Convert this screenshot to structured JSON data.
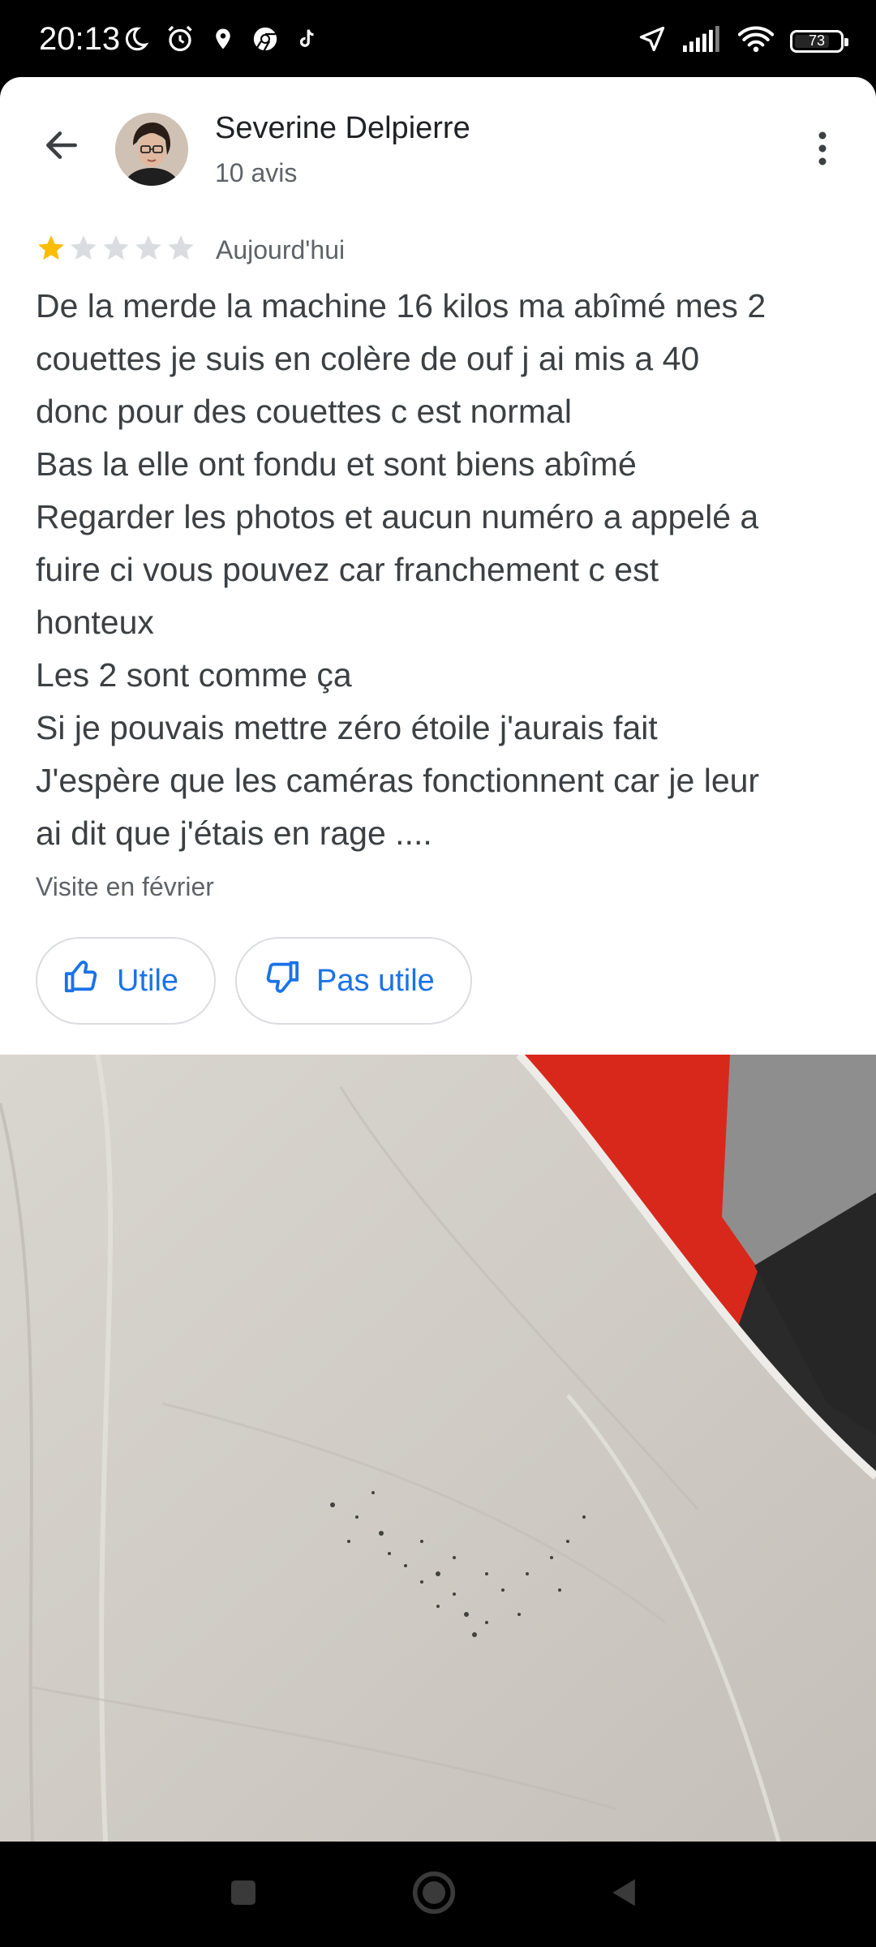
{
  "status_bar": {
    "time": "20:13",
    "battery_level": "73",
    "left_icons": [
      "moon-icon",
      "alarm-icon",
      "location-icon",
      "chrome-icon",
      "tiktok-icon"
    ],
    "right_icons": [
      "navigation-icon",
      "signal-icon",
      "wifi-icon",
      "battery-icon"
    ]
  },
  "header": {
    "reviewer_name": "Severine Delpierre",
    "review_count": "10 avis",
    "back_icon": "arrow-back-icon",
    "more_icon": "more-vert-icon"
  },
  "review": {
    "rating": 1,
    "max_rating": 5,
    "date": "Aujourd'hui",
    "text_lines": [
      "De la merde la machine 16 kilos ma abîmé mes 2",
      "couettes je suis en colère de ouf j ai mis a 40",
      "donc pour des couettes c est normal",
      "Bas la elle ont fondu et sont biens abîmé",
      "Regarder les photos et aucun numéro a appelé a",
      "fuire ci vous pouvez car franchement c est",
      "honteux",
      "Les 2 sont comme ça",
      "Si je pouvais mettre zéro étoile j'aurais fait",
      "J'espère que les caméras fonctionnent car je leur",
      "ai dit que j'étais en rage ...."
    ],
    "visit": "Visite en février"
  },
  "actions": {
    "helpful_label": "Utile",
    "not_helpful_label": "Pas utile"
  },
  "colors": {
    "accent": "#1a73e8",
    "star_filled": "#fbbc04",
    "star_empty": "#dadce0",
    "text_primary": "#202124",
    "text_secondary": "#5f6368"
  }
}
